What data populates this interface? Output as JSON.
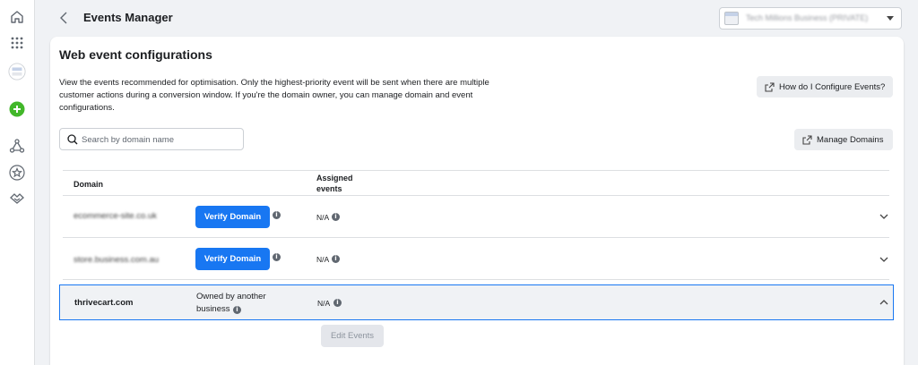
{
  "topbar": {
    "title": "Events Manager",
    "account_name": "Tech Millions Business (PRIVATE)"
  },
  "card": {
    "title": "Web event configurations",
    "description": "View the events recommended for optimisation. Only the highest-priority event will be sent when there are multiple customer actions during a conversion window. If you're the domain owner, you can manage domain and event configurations.",
    "help_button": "How do I Configure Events?",
    "manage_button": "Manage Domains",
    "search_placeholder": "Search by domain name"
  },
  "table": {
    "col_domain": "Domain",
    "col_assigned": "Assigned\nevents",
    "rows": [
      {
        "domain": "ecommerce-site.co.uk",
        "action": "Verify Domain",
        "assigned": "N/A"
      },
      {
        "domain": "store.business.com.au",
        "action": "Verify Domain",
        "assigned": "N/A"
      },
      {
        "domain": "thrivecart.com",
        "status": "Owned by another business",
        "assigned": "N/A"
      }
    ]
  },
  "edit_button": "Edit Events",
  "colors": {
    "accent": "#1877f2",
    "page_bg": "#f0f2f5",
    "green": "#42b72a"
  },
  "icons": [
    "home-icon",
    "apps-grid-icon",
    "account-avatar-icon",
    "add-icon",
    "network-icon",
    "star-icon",
    "partner-icon",
    "back-arrow-icon",
    "external-link-icon",
    "search-icon",
    "info-icon",
    "chevron-down-icon",
    "chevron-up-icon"
  ]
}
